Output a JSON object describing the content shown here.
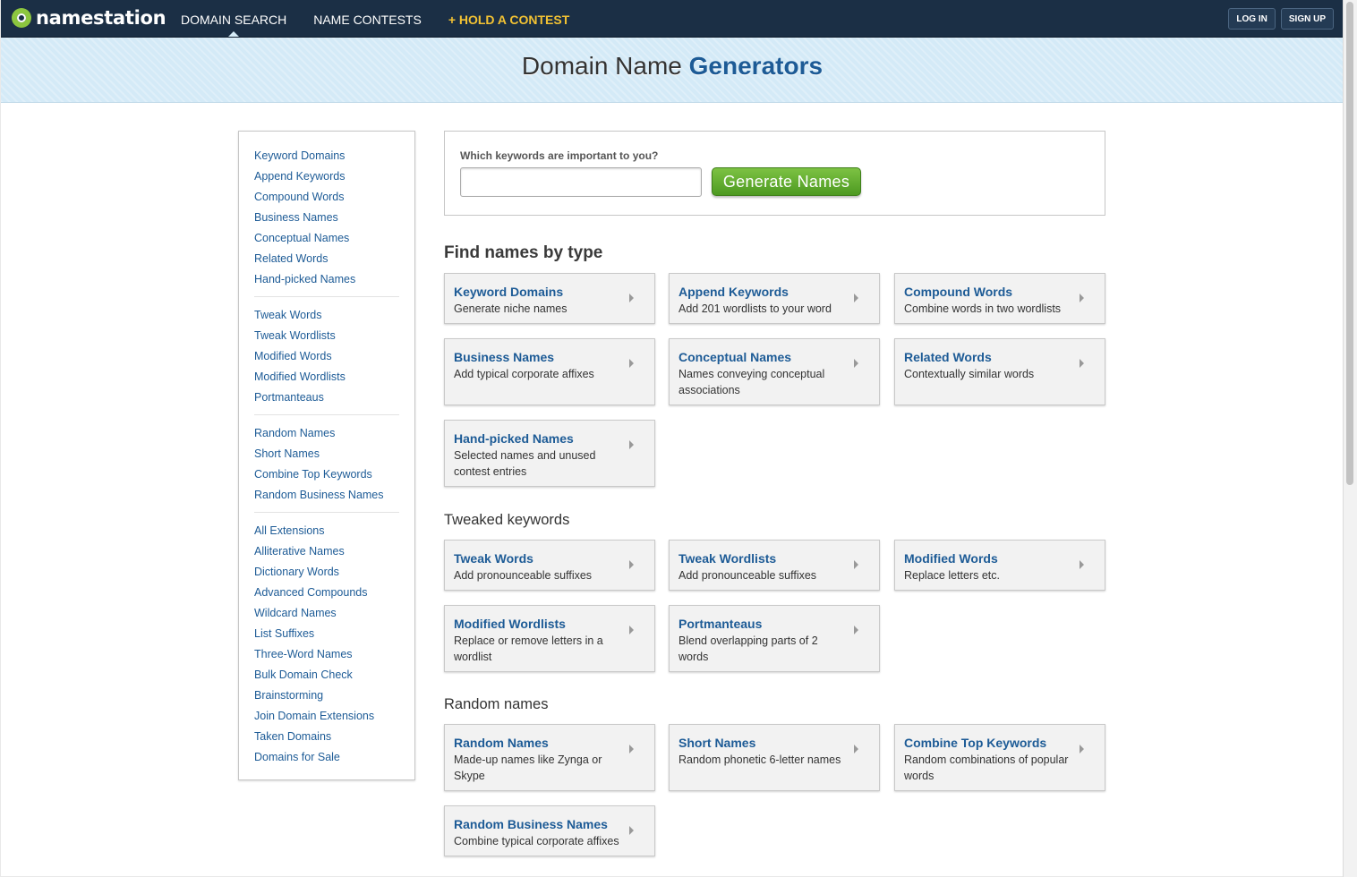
{
  "brand": {
    "name": "namestation"
  },
  "nav": {
    "items": [
      {
        "label": "DOMAIN SEARCH"
      },
      {
        "label": "NAME CONTESTS"
      },
      {
        "label": "+ HOLD A CONTEST"
      }
    ],
    "login": "LOG IN",
    "signup": "SIGN UP"
  },
  "banner": {
    "title_plain": "Domain Name",
    "title_bold": "Generators"
  },
  "sidebar": {
    "groups": [
      [
        "Keyword Domains",
        "Append Keywords",
        "Compound Words",
        "Business Names",
        "Conceptual Names",
        "Related Words",
        "Hand-picked Names"
      ],
      [
        "Tweak Words",
        "Tweak Wordlists",
        "Modified Words",
        "Modified Wordlists",
        "Portmanteaus"
      ],
      [
        "Random Names",
        "Short Names",
        "Combine Top Keywords",
        "Random Business Names"
      ],
      [
        "All Extensions",
        "Alliterative Names",
        "Dictionary Words",
        "Advanced Compounds",
        "Wildcard Names",
        "List Suffixes",
        "Three-Word Names",
        "Bulk Domain Check",
        "Brainstorming",
        "Join Domain Extensions",
        "Taken Domains",
        "Domains for Sale"
      ]
    ]
  },
  "search": {
    "label": "Which keywords are important to you?",
    "value": "",
    "placeholder": "",
    "button": "Generate  Names"
  },
  "sections": [
    {
      "title": "Find names by type",
      "cards": [
        {
          "title": "Keyword Domains",
          "desc": "Generate niche names"
        },
        {
          "title": "Append Keywords",
          "desc": "Add 201 wordlists to your word"
        },
        {
          "title": "Compound Words",
          "desc": "Combine words in two wordlists"
        },
        {
          "title": "Business Names",
          "desc": "Add typical corporate affixes"
        },
        {
          "title": "Conceptual Names",
          "desc": "Names conveying conceptual associations"
        },
        {
          "title": "Related Words",
          "desc": "Contextually similar words"
        },
        {
          "title": "Hand-picked Names",
          "desc": "Selected names and unused contest entries"
        }
      ]
    },
    {
      "title": "Tweaked keywords",
      "cards": [
        {
          "title": "Tweak Words",
          "desc": "Add pronounceable suffixes"
        },
        {
          "title": "Tweak Wordlists",
          "desc": "Add pronounceable suffixes"
        },
        {
          "title": "Modified Words",
          "desc": "Replace letters etc."
        },
        {
          "title": "Modified Wordlists",
          "desc": "Replace or remove letters in a wordlist"
        },
        {
          "title": "Portmanteaus",
          "desc": "Blend overlapping parts of 2 words"
        }
      ]
    },
    {
      "title": "Random names",
      "cards": [
        {
          "title": "Random Names",
          "desc": "Made-up names like Zynga or Skype"
        },
        {
          "title": "Short Names",
          "desc": "Random phonetic 6-letter names"
        },
        {
          "title": "Combine Top Keywords",
          "desc": "Random combinations of popular words"
        },
        {
          "title": "Random Business Names",
          "desc": "Combine typical corporate affixes"
        }
      ]
    }
  ],
  "icons": {
    "card_arrow": "caret-right-icon",
    "logo": "namestation-logo-icon"
  },
  "colors": {
    "nav_bg": "#1b2f45",
    "link": "#1d5b96",
    "accent": "#f2c233",
    "button_green": "#5aa82b"
  }
}
